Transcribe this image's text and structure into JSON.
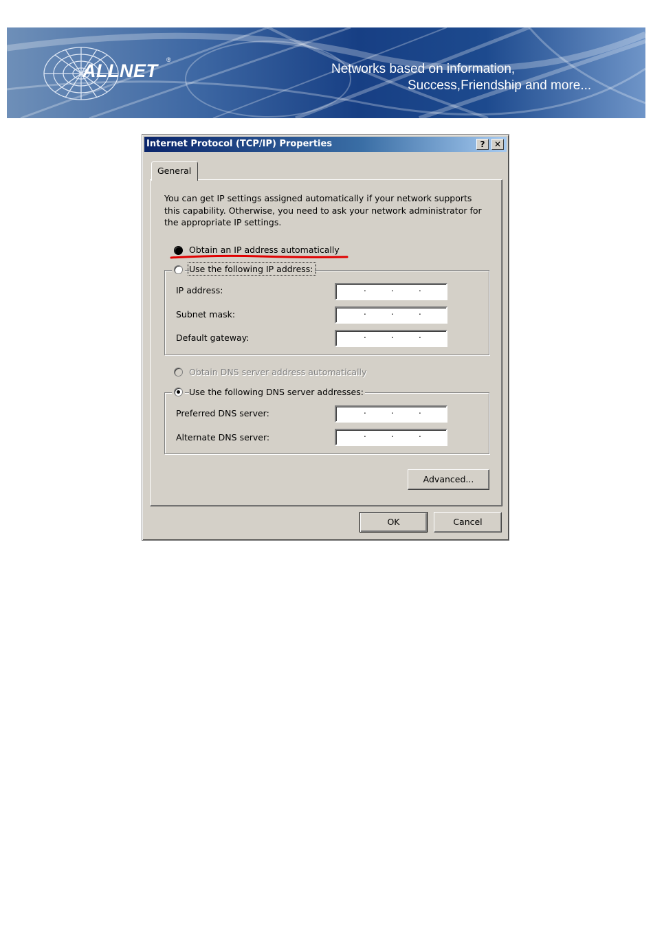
{
  "banner": {
    "brand": "ALLNET",
    "registered": "®",
    "slogan_line1": "Networks based on information,",
    "slogan_line2": "Success,Friendship and more..."
  },
  "dialog": {
    "title": "Internet Protocol (TCP/IP) Properties",
    "help_button": "?",
    "close_button": "✕",
    "tab_label": "General",
    "intro_lines": [
      "You can get IP settings assigned automatically if your network supports",
      "this capability. Otherwise, you need to ask your network administrator for",
      "the appropriate IP settings."
    ],
    "ip_mode": {
      "auto_label": "Obtain an IP address automatically",
      "manual_label": "Use the following IP address:",
      "selected": "auto"
    },
    "ip_fields": {
      "ip_address_label": "IP address:",
      "subnet_mask_label": "Subnet mask:",
      "default_gateway_label": "Default gateway:",
      "ip_address_value": ". . .",
      "subnet_mask_value": ". . .",
      "default_gateway_value": ". . ."
    },
    "dns_mode": {
      "auto_label": "Obtain DNS server address automatically",
      "manual_label": "Use the following DNS server addresses:",
      "selected": "manual",
      "auto_enabled": false
    },
    "dns_fields": {
      "preferred_label": "Preferred DNS server:",
      "alternate_label": "Alternate DNS server:",
      "preferred_value": ". . .",
      "alternate_value": ". . ."
    },
    "advanced_button": "Advanced...",
    "ok_button": "OK",
    "cancel_button": "Cancel",
    "annotation_color": "#e00000",
    "title_bar_color": "#0a246a",
    "face_color": "#d4d0c8"
  }
}
